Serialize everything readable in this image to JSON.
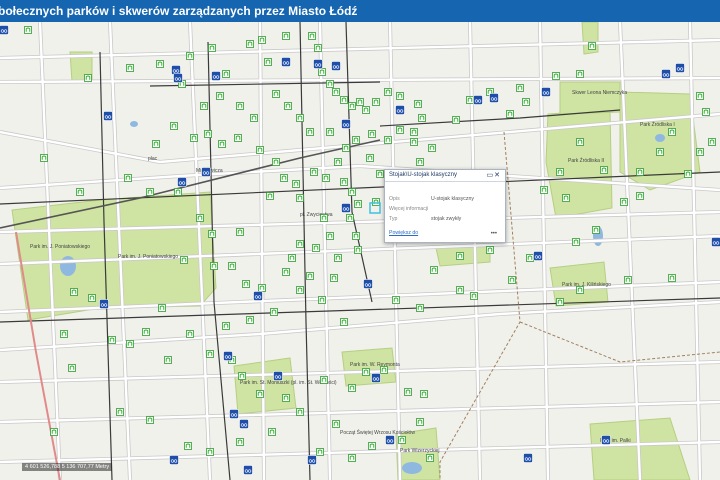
{
  "title": "bołecznych parków i skwerów zarządzanych przez Miasto Łódź",
  "popup": {
    "title": "Stojak\\U-stojak klasyczny",
    "controls": "▭✕",
    "rows": [
      {
        "label": "Opis",
        "value": "U-stojak klasyczny"
      },
      {
        "label": "Więcej informacji",
        "value": ""
      },
      {
        "label": "Typ",
        "value": "stojak zwykły"
      }
    ],
    "zoom_link": "Powiększ do",
    "more": "•••"
  },
  "coordinates": "4 601 526,788 5 136 707,77 Metry",
  "map_labels": [
    {
      "id": "park-poniatowskiego",
      "text": "Park im. J. Poniatowskiego"
    },
    {
      "id": "park-poniatowskiego2",
      "text": "Park im. J. Poniatowskiego"
    },
    {
      "id": "park-zrodliska1",
      "text": "Park Źródliska I"
    },
    {
      "id": "park-zrodliska2",
      "text": "Park Źródliska II"
    },
    {
      "id": "park-kilinskiego",
      "text": "Park im. J. Kilińskiego"
    },
    {
      "id": "skwer-leona",
      "text": "Skwer Leona Niemczyka"
    },
    {
      "id": "park-reymonta",
      "text": "Park im. W. Reymonta"
    },
    {
      "id": "park-moniuszki",
      "text": "Park im. St. Moniuszki (pl. im. St. Wolności)"
    },
    {
      "id": "park-palki",
      "text": "Park im. Palki"
    },
    {
      "id": "park-wizerzyckiej",
      "text": "Park Wizerzyckiej"
    },
    {
      "id": "park-poczatek",
      "text": "Począt Świętej Wrzosu Kościołów"
    },
    {
      "id": "mickiewicza",
      "text": "Mickiewicza"
    },
    {
      "id": "zwyciestwa",
      "text": "pl. Zwycięstwa"
    },
    {
      "id": "plac",
      "text": "plac"
    }
  ],
  "icons": {
    "bike_rack": "bike-rack-icon",
    "bike_station": "bike-station-icon"
  },
  "colors": {
    "park": "#cfe3a2",
    "park_border": "#b5cf82",
    "road": "#ffffff",
    "road_casing": "#c9c9c9",
    "rail": "#3a3a3a",
    "water": "#8fb8e0",
    "title_bg": "#1565b0"
  }
}
